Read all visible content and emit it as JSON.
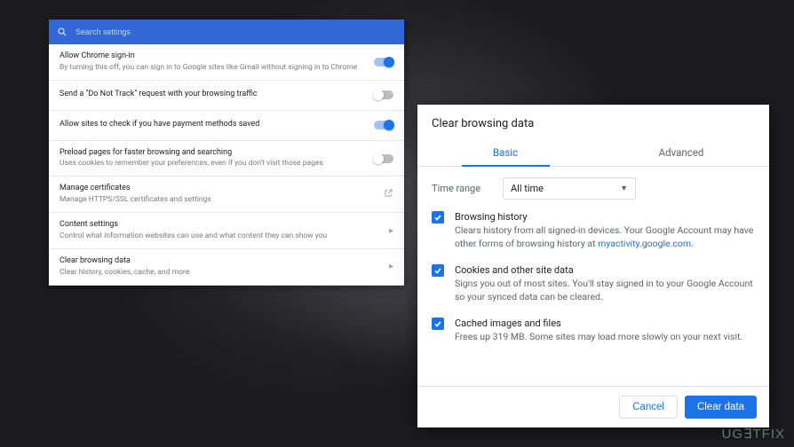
{
  "search": {
    "placeholder": "Search settings"
  },
  "settings": [
    {
      "title": "Allow Chrome sign-in",
      "subtitle": "By turning this off, you can sign in to Google sites like Gmail without signing in to Chrome",
      "control": "toggle",
      "state": "on"
    },
    {
      "title": "Send a \"Do Not Track\" request with your browsing traffic",
      "subtitle": "",
      "control": "toggle",
      "state": "off"
    },
    {
      "title": "Allow sites to check if you have payment methods saved",
      "subtitle": "",
      "control": "toggle",
      "state": "on"
    },
    {
      "title": "Preload pages for faster browsing and searching",
      "subtitle": "Uses cookies to remember your preferences, even if you don't visit those pages",
      "control": "toggle",
      "state": "off"
    },
    {
      "title": "Manage certificates",
      "subtitle": "Manage HTTPS/SSL certificates and settings",
      "control": "external"
    },
    {
      "title": "Content settings",
      "subtitle": "Control what information websites can use and what content they can show you",
      "control": "arrow"
    },
    {
      "title": "Clear browsing data",
      "subtitle": "Clear history, cookies, cache, and more",
      "control": "arrow"
    }
  ],
  "dialog": {
    "title": "Clear browsing data",
    "tabs": {
      "basic": "Basic",
      "advanced": "Advanced"
    },
    "time_range_label": "Time range",
    "time_range_value": "All time",
    "items": [
      {
        "title": "Browsing history",
        "desc_before": "Clears history from all signed-in devices. Your Google Account may have other forms of browsing history at ",
        "link": "myactivity.google.com",
        "desc_after": "."
      },
      {
        "title": "Cookies and other site data",
        "desc_before": "Signs you out of most sites. You'll stay signed in to your Google Account so your synced data can be cleared.",
        "link": "",
        "desc_after": ""
      },
      {
        "title": "Cached images and files",
        "desc_before": "Frees up 319 MB. Some sites may load more slowly on your next visit.",
        "link": "",
        "desc_after": ""
      }
    ],
    "cancel": "Cancel",
    "confirm": "Clear data"
  },
  "watermark": "UG∃TFIX"
}
